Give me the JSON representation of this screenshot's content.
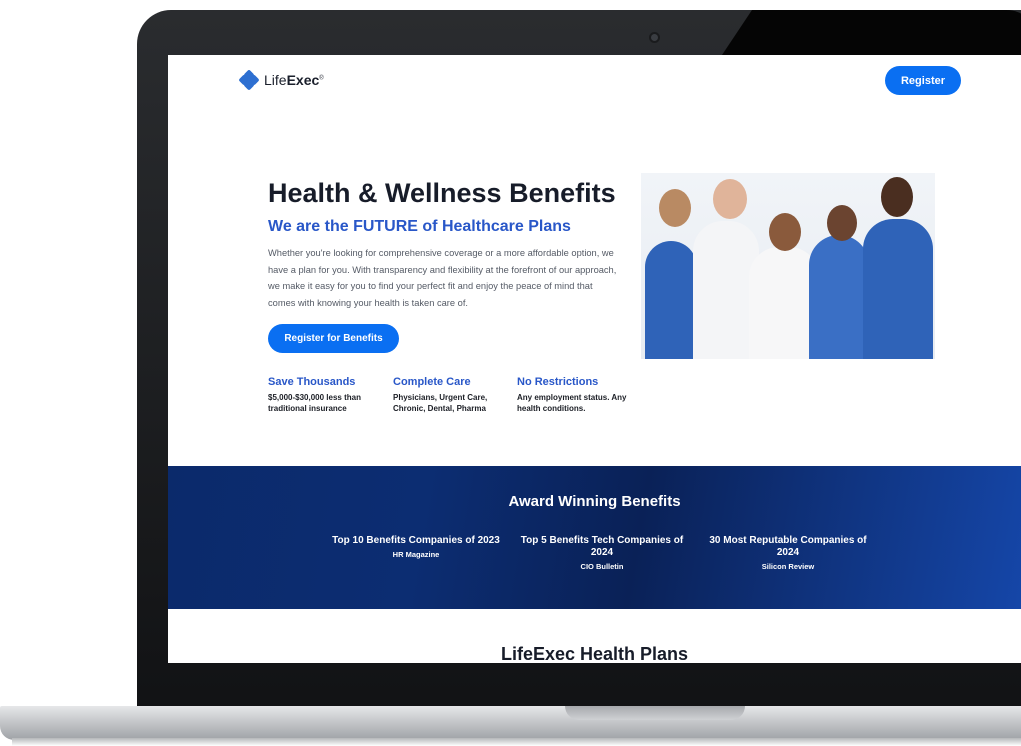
{
  "header": {
    "logo_light": "Life",
    "logo_bold": "Exec",
    "logo_mark": "®",
    "register_label": "Register"
  },
  "hero": {
    "title": "Health & Wellness Benefits",
    "subtitle": "We are the FUTURE of Healthcare Plans",
    "body": "Whether you're looking for comprehensive coverage or a more affordable option, we have a plan for you. With transparency and flexibility at the forefront of our approach, we make it easy for you to find your perfect fit and enjoy the peace of mind that comes with knowing your health is taken care of.",
    "cta_label": "Register for Benefits"
  },
  "features": [
    {
      "title": "Save Thousands",
      "desc": "$5,000-$30,000 less than traditional insurance"
    },
    {
      "title": "Complete Care",
      "desc": "Physicians, Urgent Care, Chronic, Dental, Pharma"
    },
    {
      "title": "No Restrictions",
      "desc": "Any employment status. Any health conditions."
    }
  ],
  "awards": {
    "title": "Award Winning Benefits",
    "items": [
      {
        "title": "Top 10 Benefits Companies of 2023",
        "source": "HR Magazine"
      },
      {
        "title": "Top 5 Benefits Tech Companies of 2024",
        "source": "CIO Bulletin"
      },
      {
        "title": "30 Most Reputable Companies of 2024",
        "source": "Silicon Review"
      }
    ]
  },
  "plans": {
    "title": "LifeExec Health Plans"
  },
  "colors": {
    "accent": "#0a6ff2",
    "heading_blue": "#2957c8",
    "award_band": "#0b2a6b"
  }
}
